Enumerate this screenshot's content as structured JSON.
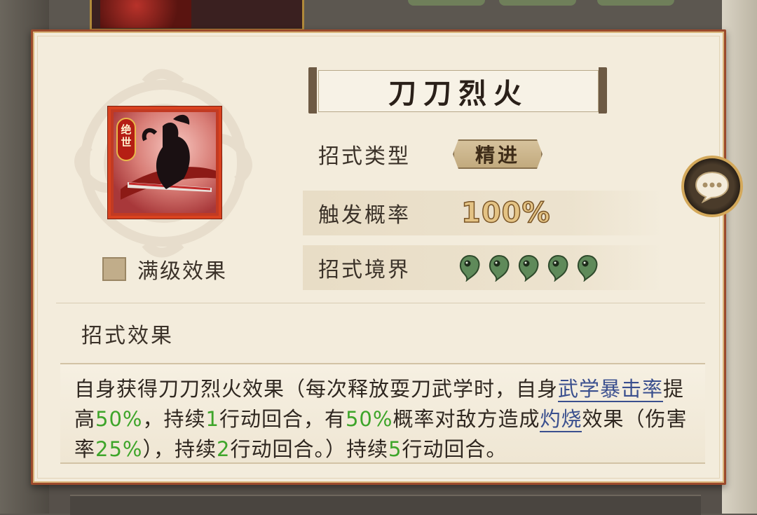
{
  "skill": {
    "title": "刀刀烈火",
    "badge": "绝世",
    "full_level_label": "满级效果",
    "type_label": "招式类型",
    "type_value": "精进",
    "trigger_label": "触发概率",
    "trigger_value": "100%",
    "realm_label": "招式境界",
    "realm_level": 5
  },
  "effect": {
    "section_title": "招式效果",
    "p1": "自身获得刀刀烈火效果（每次释放耍刀武学时，自身",
    "link1": "武学暴击率",
    "p2": "提高",
    "v1": "50%",
    "p3": "，持续",
    "v2": "1",
    "p4": "行动回合，有",
    "v3": "50%",
    "p5": "概率对敌方造成",
    "link2": "灼烧",
    "p6": "效果（伤害率",
    "v4": "25%",
    "p7": "），持续",
    "v5": "2",
    "p8": "行动回合。）持续",
    "v6": "5",
    "p9": "行动回合。"
  },
  "colors": {
    "border": "#9b4a2c",
    "panel": "#f3ecdc",
    "highlight_green": "#3ea52a",
    "link_blue": "#3a4f8e",
    "realm_jade": "#5f8a5a"
  },
  "icons": {
    "chat": "chat-bubble-icon",
    "realm": "magatama-icon"
  }
}
